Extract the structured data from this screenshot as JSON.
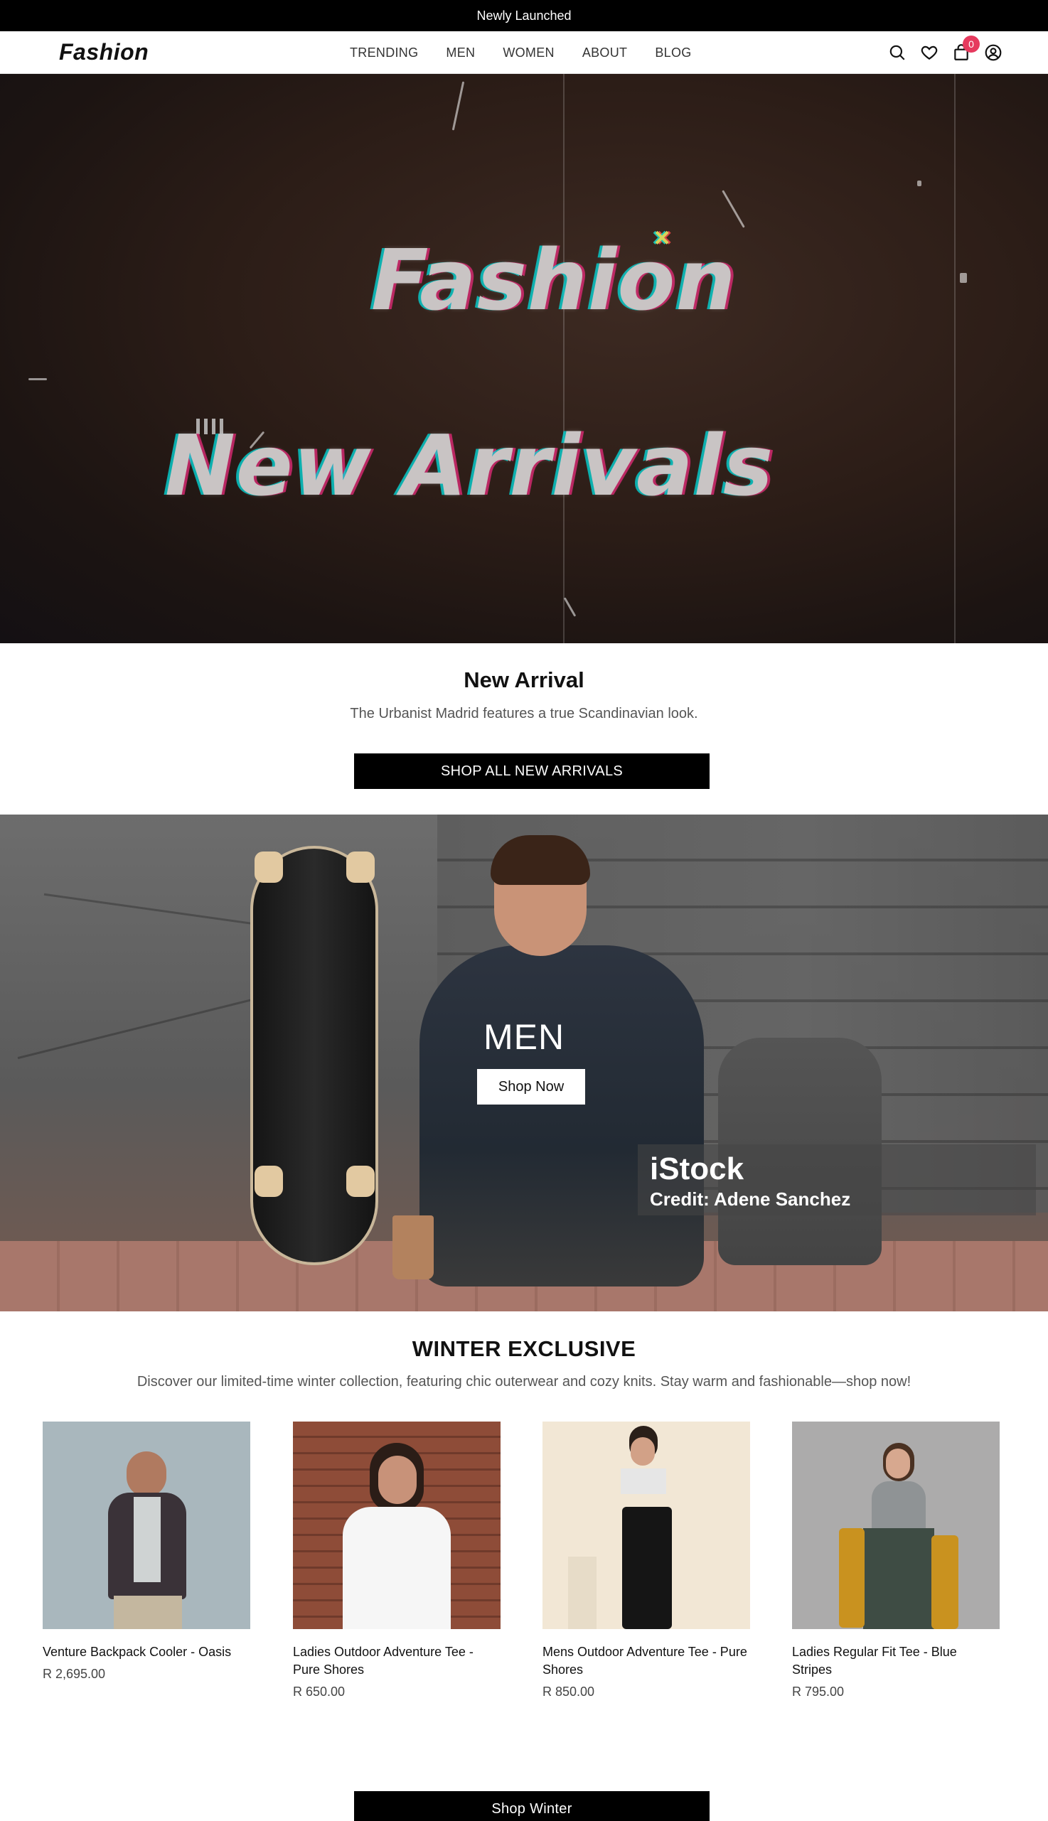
{
  "announcement": "Newly Launched",
  "header": {
    "logo": "Fashion",
    "nav": [
      "TRENDING",
      "MEN",
      "WOMEN",
      "ABOUT",
      "BLOG"
    ],
    "icons": [
      "search-icon",
      "heart-icon",
      "shopping-bag-icon",
      "account-icon"
    ],
    "cart_count": "0"
  },
  "hero": {
    "line1": "Fashion",
    "line2": "New Arrivals"
  },
  "new_arrival": {
    "title": "New Arrival",
    "subtitle": "The Urbanist Madrid features a true Scandinavian look.",
    "button": "SHOP ALL NEW ARRIVALS"
  },
  "men_banner": {
    "title": "MEN",
    "button": "Shop Now",
    "watermark": "iStock",
    "credit": "Credit: Adene Sanchez"
  },
  "winter": {
    "title": "WINTER EXCLUSIVE",
    "subtitle": "Discover our limited-time winter collection, featuring chic outerwear and cozy knits. Stay warm and fashionable—shop now!",
    "products": [
      {
        "name": "Venture Backpack Cooler - Oasis",
        "price": "R 2,695.00"
      },
      {
        "name": "Ladies Outdoor Adventure Tee - Pure Shores",
        "price": "R 650.00"
      },
      {
        "name": "Mens Outdoor Adventure Tee - Pure Shores",
        "price": "R 850.00"
      },
      {
        "name": "Ladies Regular Fit Tee - Blue Stripes",
        "price": "R 795.00"
      }
    ],
    "button": "Shop Winter"
  },
  "colors": {
    "accent_badge": "#e63a5e",
    "bar": "#000000"
  }
}
